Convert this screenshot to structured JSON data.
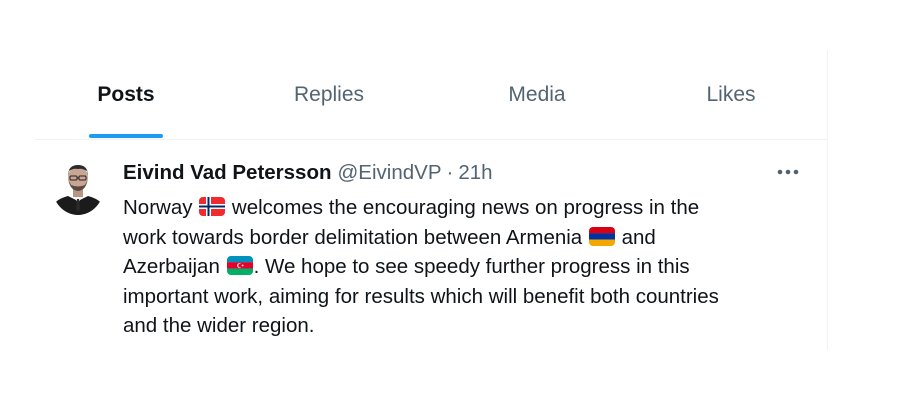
{
  "tabs": [
    {
      "label": "Posts",
      "active": true
    },
    {
      "label": "Replies",
      "active": false
    },
    {
      "label": "Media",
      "active": false
    },
    {
      "label": "Likes",
      "active": false
    }
  ],
  "post": {
    "author_name": "Eivind Vad Petersson",
    "handle": "@EivindVP",
    "separator": "·",
    "time": "21h",
    "more_icon": "more-horizontal-icon",
    "text_segments": {
      "s1": "Norway",
      "s2": "welcomes the encouraging news on progress in the",
      "s3": "work towards border delimitation between Armenia",
      "s4": "and",
      "s5": "Azerbaijan",
      "s6": ". We hope to see speedy further progress in this",
      "s7": "important work, aiming for results which will benefit both countries",
      "s8": "and the wider region."
    },
    "flags": [
      "norway-flag-icon",
      "armenia-flag-icon",
      "azerbaijan-flag-icon"
    ]
  },
  "colors": {
    "accent": "#1d9bf0",
    "text_primary": "#0f1419",
    "text_secondary": "#536471",
    "divider": "#eff3f4"
  }
}
